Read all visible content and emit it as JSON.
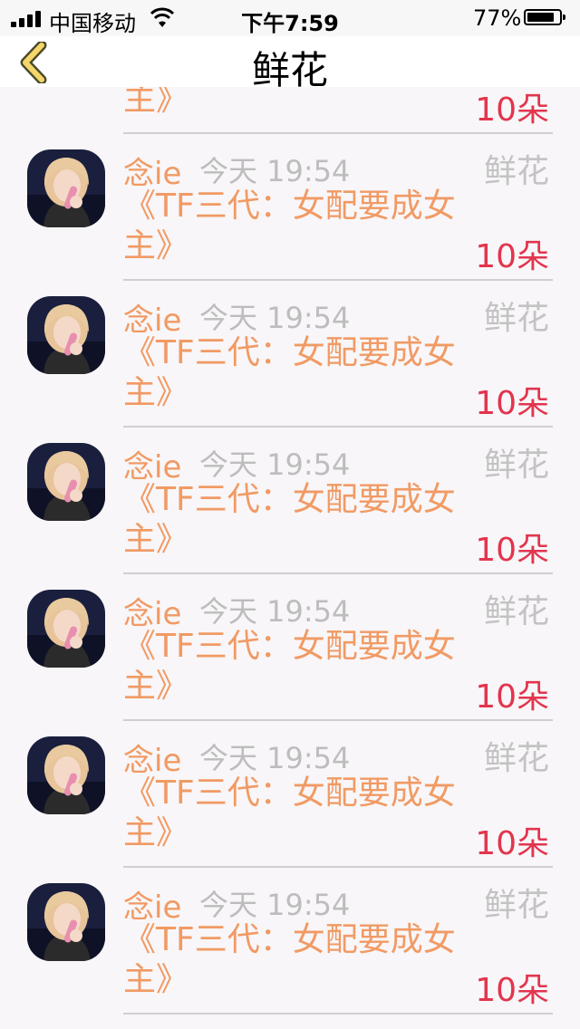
{
  "status_bar": {
    "carrier": "中国移动",
    "time": "下午7:59",
    "battery_percent": "77%",
    "battery_level": 0.77
  },
  "nav": {
    "title": "鲜花",
    "back_icon": "chevron-left-icon"
  },
  "colors": {
    "accent_orange": "#f19a64",
    "count_red": "#e2354e",
    "muted_gray": "#bdbdbd",
    "background": "#f8f6f8"
  },
  "partial_row": {
    "book_title_tail": "主》",
    "gift_count": "10朵"
  },
  "rows": [
    {
      "user": "念ie",
      "time": "今天 19:54",
      "gift": "鲜花",
      "book_title": "《TF三代：女配要成女主》",
      "count": "10朵"
    },
    {
      "user": "念ie",
      "time": "今天 19:54",
      "gift": "鲜花",
      "book_title": "《TF三代：女配要成女主》",
      "count": "10朵"
    },
    {
      "user": "念ie",
      "time": "今天 19:54",
      "gift": "鲜花",
      "book_title": "《TF三代：女配要成女主》",
      "count": "10朵"
    },
    {
      "user": "念ie",
      "time": "今天 19:54",
      "gift": "鲜花",
      "book_title": "《TF三代：女配要成女主》",
      "count": "10朵"
    },
    {
      "user": "念ie",
      "time": "今天 19:54",
      "gift": "鲜花",
      "book_title": "《TF三代：女配要成女主》",
      "count": "10朵"
    },
    {
      "user": "念ie",
      "time": "今天 19:54",
      "gift": "鲜花",
      "book_title": "《TF三代：女配要成女主》",
      "count": "10朵"
    }
  ]
}
